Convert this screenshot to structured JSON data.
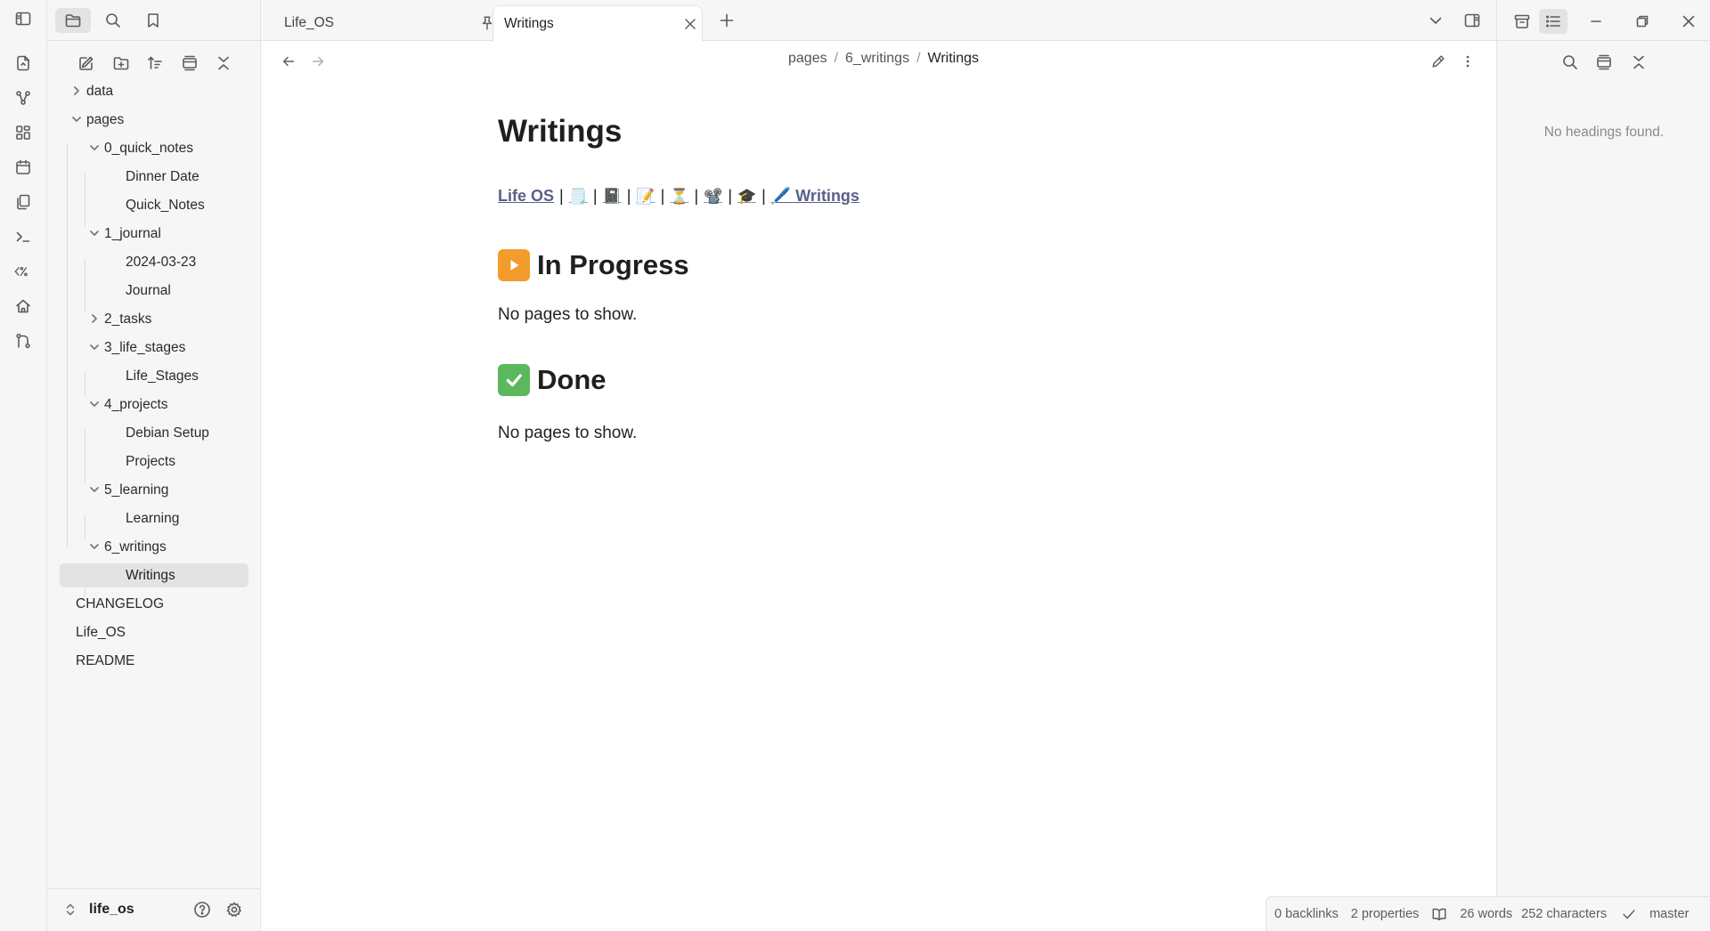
{
  "app": {
    "accent": "#5a5f87"
  },
  "tabs": [
    {
      "label": "Life_OS",
      "pinned": true,
      "active": false
    },
    {
      "label": "Writings",
      "pinned": false,
      "active": true
    }
  ],
  "sidebar": {
    "tree": [
      {
        "label": "data",
        "type": "folder",
        "expanded": false
      },
      {
        "label": "pages",
        "type": "folder",
        "expanded": true
      },
      {
        "label": "0_quick_notes",
        "type": "folder",
        "expanded": true
      },
      {
        "label": "Dinner Date",
        "type": "file"
      },
      {
        "label": "Quick_Notes",
        "type": "file"
      },
      {
        "label": "1_journal",
        "type": "folder",
        "expanded": true
      },
      {
        "label": "2024-03-23",
        "type": "file"
      },
      {
        "label": "Journal",
        "type": "file"
      },
      {
        "label": "2_tasks",
        "type": "folder",
        "expanded": false
      },
      {
        "label": "3_life_stages",
        "type": "folder",
        "expanded": true
      },
      {
        "label": "Life_Stages",
        "type": "file"
      },
      {
        "label": "4_projects",
        "type": "folder",
        "expanded": true
      },
      {
        "label": "Debian Setup",
        "type": "file"
      },
      {
        "label": "Projects",
        "type": "file"
      },
      {
        "label": "5_learning",
        "type": "folder",
        "expanded": true
      },
      {
        "label": "Learning",
        "type": "file"
      },
      {
        "label": "6_writings",
        "type": "folder",
        "expanded": true
      },
      {
        "label": "Writings",
        "type": "file",
        "selected": true
      },
      {
        "label": "CHANGELOG",
        "type": "file"
      },
      {
        "label": "Life_OS",
        "type": "file"
      },
      {
        "label": "README",
        "type": "file"
      }
    ],
    "vault_name": "life_os"
  },
  "breadcrumb": {
    "items": [
      "pages",
      "6_writings"
    ],
    "current": "Writings",
    "separator": "/"
  },
  "note": {
    "title": "Writings",
    "nav": {
      "home_link": "Life OS",
      "separator": "|",
      "emojis": [
        "🗒️",
        "📓",
        "📝",
        "⏳",
        "📽️",
        "🎓"
      ],
      "writings_link": "🖊️ Writings"
    },
    "sections": [
      {
        "emoji": "▶",
        "heading": "In Progress",
        "body": "No pages to show.",
        "badge_color": "#f39c2b"
      },
      {
        "emoji": "✔",
        "heading": "Done",
        "body": "No pages to show.",
        "badge_color": "#5cb85c"
      }
    ]
  },
  "outline": {
    "empty_text": "No headings found."
  },
  "status": {
    "backlinks": "0 backlinks",
    "properties": "2 properties",
    "words": "26 words",
    "characters": "252 characters",
    "branch": "master"
  }
}
